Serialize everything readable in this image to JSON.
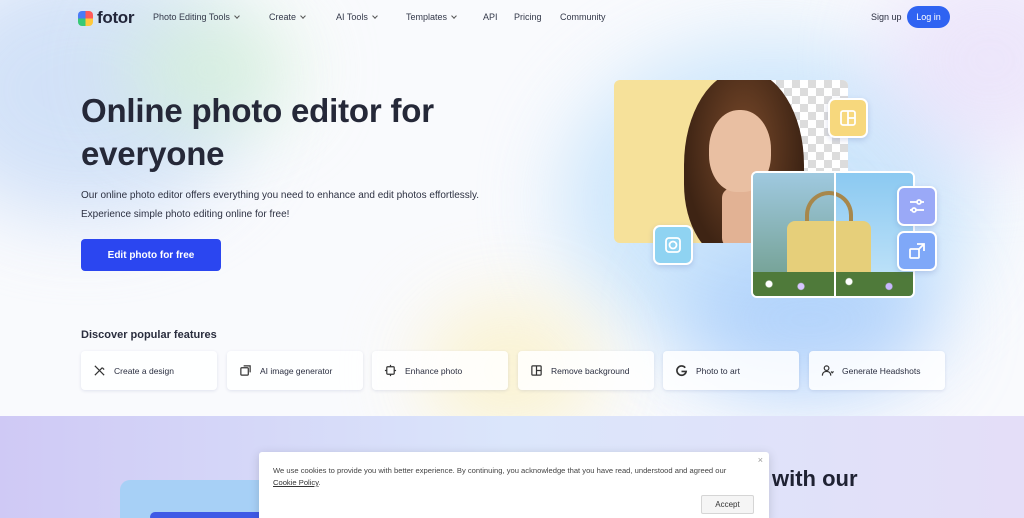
{
  "nav": {
    "logo": "fotor",
    "items": [
      {
        "label": "Photo Editing Tools",
        "dropdown": true
      },
      {
        "label": "Create",
        "dropdown": true
      },
      {
        "label": "AI Tools",
        "dropdown": true
      },
      {
        "label": "Templates",
        "dropdown": true
      },
      {
        "label": "API",
        "dropdown": false
      },
      {
        "label": "Pricing",
        "dropdown": false
      },
      {
        "label": "Community",
        "dropdown": false
      }
    ],
    "signup": "Sign up",
    "login": "Log in"
  },
  "hero": {
    "title": "Online photo editor for everyone",
    "desc_line1": "Our online photo editor offers everything you need to enhance and edit photos effortlessly.",
    "desc_line2": "Experience simple photo editing online for free!",
    "cta": "Edit photo for free"
  },
  "features": {
    "title": "Discover popular features",
    "items": [
      {
        "label": "Create a design",
        "icon": "design-icon"
      },
      {
        "label": "AI image generator",
        "icon": "ai-image-icon"
      },
      {
        "label": "Enhance photo",
        "icon": "enhance-icon"
      },
      {
        "label": "Remove background",
        "icon": "remove-bg-icon"
      },
      {
        "label": "Photo to art",
        "icon": "photo-art-icon"
      },
      {
        "label": "Generate Headshots",
        "icon": "headshot-icon"
      }
    ]
  },
  "section2": {
    "title_fragment": "with our"
  },
  "cookie": {
    "text_before": "We use cookies to provide you with better experience. By continuing, you acknowledge that you have read, understood and agreed our ",
    "link": "Cookie Policy",
    "text_after": ".",
    "accept": "Accept",
    "close": "×"
  },
  "colors": {
    "accent": "#2b46f0",
    "login": "#2f63f2"
  }
}
